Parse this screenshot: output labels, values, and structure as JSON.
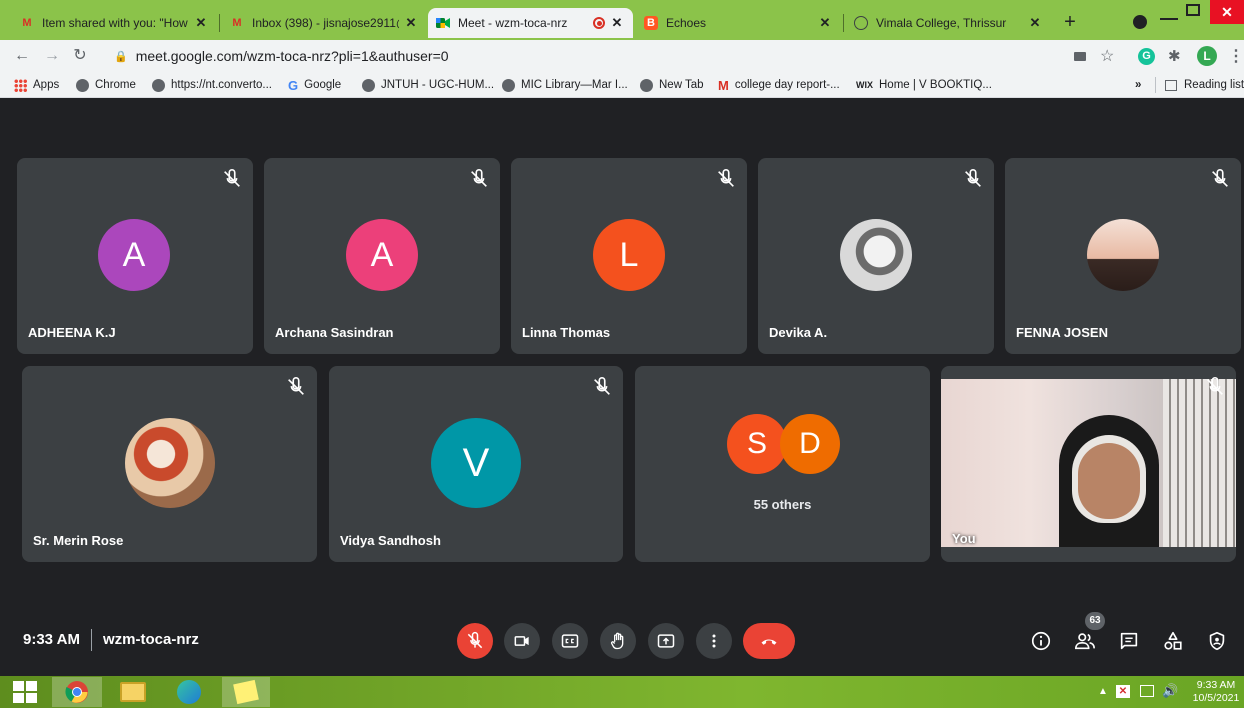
{
  "browser": {
    "tabs": [
      {
        "title": "Item shared with you: \"How to",
        "icon": "gmail-icon",
        "active": false
      },
      {
        "title": "Inbox (398) - jisnajose2911@g",
        "icon": "gmail-icon",
        "active": false
      },
      {
        "title": "Meet - wzm-toca-nrz",
        "icon": "meet-icon",
        "active": true
      },
      {
        "title": "Echoes",
        "icon": "blogger-icon",
        "active": false
      },
      {
        "title": "Vimala College, Thrissur",
        "icon": "globe-icon",
        "active": false
      }
    ],
    "new_tab": "+",
    "url": "meet.google.com/wzm-toca-nrz?pli=1&authuser=0",
    "profile_initial": "L",
    "bookmarks": [
      {
        "label": "Apps",
        "icon": "apps-grid-icon"
      },
      {
        "label": "Chrome",
        "icon": "globe-icon"
      },
      {
        "label": "https://nt.converto...",
        "icon": "globe-icon"
      },
      {
        "label": "Google",
        "icon": "google-icon"
      },
      {
        "label": "JNTUH - UGC-HUM...",
        "icon": "globe-icon"
      },
      {
        "label": "MIC Library—Mar I...",
        "icon": "globe-icon"
      },
      {
        "label": "New Tab",
        "icon": "globe-icon"
      },
      {
        "label": "college day report-...",
        "icon": "gmail-icon"
      },
      {
        "label": "Home | V BOOKTIQ...",
        "icon": "wix-icon"
      }
    ],
    "bookmarks_overflow": "»",
    "reading_list": "Reading list"
  },
  "meet": {
    "participants": [
      {
        "name": "ADHEENA K.J",
        "initial": "A",
        "color": "#ab47bc",
        "type": "letter"
      },
      {
        "name": "Archana Sasindran",
        "initial": "A",
        "color": "#ec407a",
        "type": "letter"
      },
      {
        "name": "Linna Thomas",
        "initial": "L",
        "color": "#f4511e",
        "type": "letter"
      },
      {
        "name": "Devika A.",
        "initial": "",
        "color": "#cfcfcf",
        "type": "photo"
      },
      {
        "name": "FENNA JOSEN",
        "initial": "",
        "color": "#e0b89a",
        "type": "photo"
      },
      {
        "name": "Sr. Merin Rose",
        "initial": "",
        "color": "#d9a27a",
        "type": "photo"
      },
      {
        "name": "Vidya Sandhosh",
        "initial": "V",
        "color": "#0097a7",
        "type": "letter"
      }
    ],
    "others": {
      "initials": [
        "S",
        "D"
      ],
      "colors": [
        "#f4511e",
        "#ef6c00"
      ],
      "label": "55 others"
    },
    "self_label": "You",
    "time": "9:33 AM",
    "meeting_code": "wzm-toca-nrz",
    "participant_count": "63"
  },
  "taskbar": {
    "time": "9:33 AM",
    "date": "10/5/2021"
  }
}
